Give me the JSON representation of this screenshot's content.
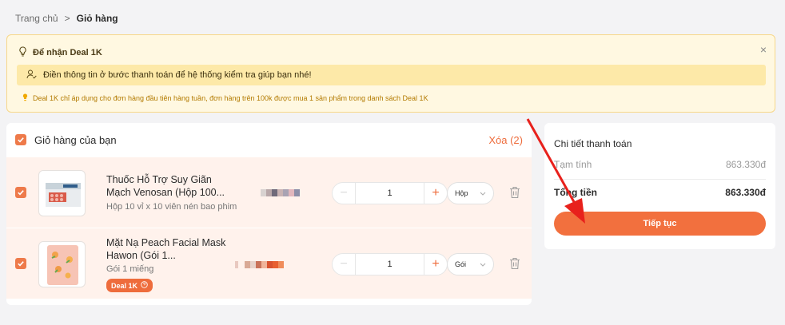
{
  "breadcrumb": {
    "home": "Trang chủ",
    "separator": ">",
    "current": "Giỏ hàng"
  },
  "notice": {
    "title": "Để nhận Deal 1K",
    "close": "×",
    "message": "Điền thông tin ở bước thanh toán để hệ thống kiểm tra giúp bạn nhé!",
    "footnote": "Deal 1K chỉ áp dụng cho đơn hàng đầu tiên hàng tuần, đơn hàng trên 100k được mua 1 sản phẩm trong danh sách Deal 1K"
  },
  "cart": {
    "title": "Giỏ hàng của bạn",
    "delete_label": "Xóa (2)",
    "items": [
      {
        "name": "Thuốc Hỗ Trợ Suy Giãn Mạch Venosan (Hộp 100...",
        "desc": "Hộp 10 vỉ x 10 viên nén bao phim",
        "qty": "1",
        "unit": "Hộp",
        "tag": ""
      },
      {
        "name": "Mặt Nạ Peach Facial Mask Hawon (Gói 1...",
        "desc": "Gói 1 miếng",
        "qty": "1",
        "unit": "Gói",
        "tag": "Deal 1K"
      }
    ]
  },
  "summary": {
    "title": "Chi tiết thanh toán",
    "subtotal_label": "Tạm tính",
    "subtotal_value": "863.330đ",
    "total_label": "Tổng tiền",
    "total_value": "863.330đ",
    "cta": "Tiếp tục"
  },
  "colors": {
    "accent": "#ee6c3c",
    "notice_bg": "#fff8e1",
    "row_bg": "#fff2ec"
  },
  "icons": [
    "lightbulb-icon",
    "close-icon",
    "user-check-icon",
    "checkbox-icon",
    "chevron-down-icon",
    "trash-icon",
    "help-circle-icon"
  ]
}
